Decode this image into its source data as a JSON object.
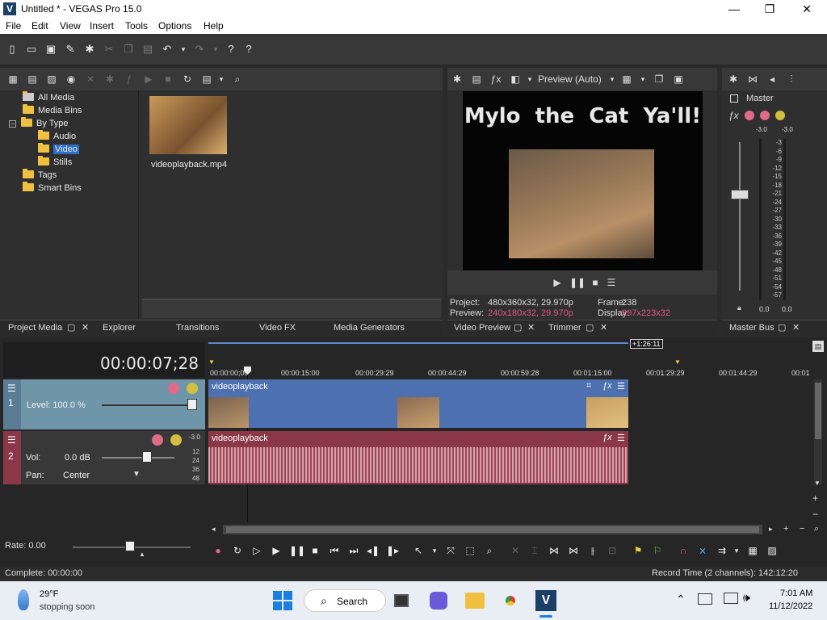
{
  "window": {
    "title": "Untitled * - VEGAS Pro 15.0",
    "app_icon": "V",
    "min": "—",
    "max": "❐",
    "close": "✕"
  },
  "menu": [
    "File",
    "Edit",
    "View",
    "Insert",
    "Tools",
    "Options",
    "Help"
  ],
  "project_media": {
    "tree": [
      "All Media",
      "Media Bins",
      "By Type",
      "Audio",
      "Video",
      "Stills",
      "Tags",
      "Smart Bins"
    ],
    "media_file": "videoplayback.mp4"
  },
  "tabs_left": {
    "project_media": "Project Media",
    "explorer": "Explorer",
    "transitions": "Transitions",
    "video_fx": "Video FX",
    "media_generators": "Media Generators"
  },
  "preview": {
    "quality": "Preview (Auto)",
    "overlay_title": "Mylo  the  Cat  Ya'll!",
    "project_label": "Project:",
    "project_value": "480x360x32, 29.970p",
    "preview_label": "Preview:",
    "preview_value": "240x180x32, 29.970p",
    "frame_label": "Frame:",
    "frame_value": "238",
    "display_label": "Display:",
    "display_value": "297x223x32",
    "tab_video_preview": "Video Preview",
    "tab_trimmer": "Trimmer"
  },
  "master": {
    "label": "Master",
    "left_peak": "-3.0",
    "right_peak": "-3.0",
    "scale": [
      "3",
      "6",
      "9",
      "12",
      "15",
      "18",
      "21",
      "24",
      "27",
      "30",
      "33",
      "36",
      "39",
      "42",
      "45",
      "48",
      "51",
      "54",
      "57"
    ],
    "bottom_left": "0.0",
    "bottom_right": "0.0",
    "tab": "Master Bus"
  },
  "timeline": {
    "timecode": "00:00:07;28",
    "marker_length": "+1:26:11",
    "ruler": [
      "00:00:00;00",
      "00:00:15:00",
      "00:00:29:29",
      "00:00:44:29",
      "00:00:59:28",
      "00:01:15:00",
      "00:01:29:29",
      "00:01:44:29",
      "00:01"
    ],
    "track1": {
      "number": "1",
      "level_label": "Level: 100.0 %",
      "clip_name": "videoplayback",
      "level_percent": 100
    },
    "track2": {
      "number": "2",
      "vol_label": "Vol:",
      "vol_value": "0.0 dB",
      "pan_label": "Pan:",
      "pan_value": "Center",
      "clip_name": "videoplayback",
      "peak": "-3.0",
      "scale": [
        "12",
        "24",
        "36",
        "48"
      ]
    },
    "rate_label": "Rate: 0.00"
  },
  "status": {
    "complete": "Complete: 00:00:00",
    "record_time": "Record Time (2 channels): 142:12:20"
  },
  "taskbar": {
    "weather_temp": "29°F",
    "weather_desc": "stopping soon",
    "search": "Search",
    "time": "7:01 AM",
    "date": "11/12/2022"
  },
  "colors": {
    "accent_selected": "#2f6fc4",
    "video_track": "#4c70b0",
    "audio_track": "#8a3848",
    "track_header": "#6e95a8"
  }
}
